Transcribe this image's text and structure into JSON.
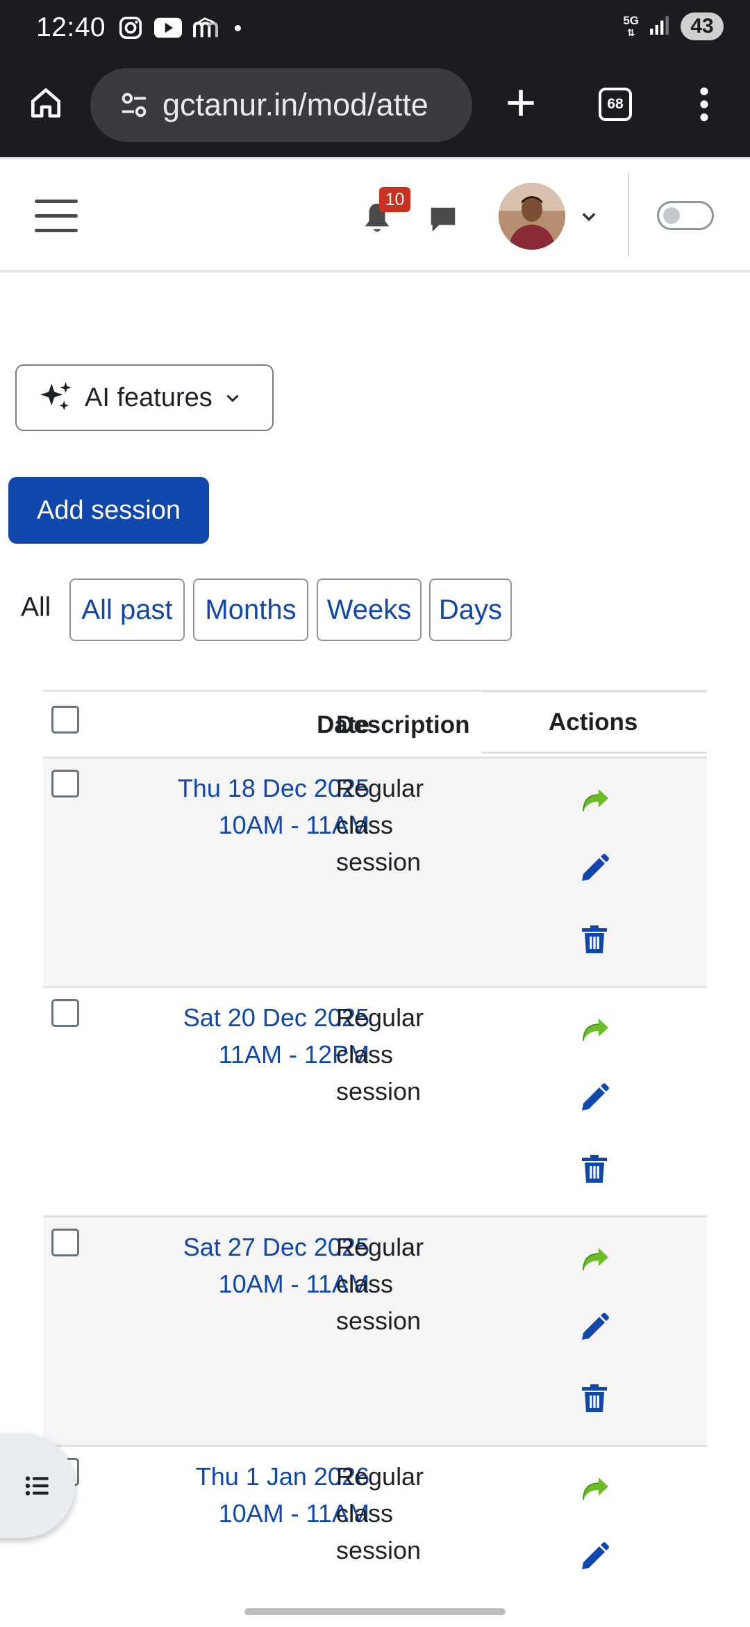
{
  "status_bar": {
    "time": "12:40",
    "network": "5G",
    "battery": "43",
    "icons": [
      "instagram-icon",
      "youtube-icon",
      "moodle-icon",
      "notification-dot-icon",
      "signal-icon",
      "battery-icon"
    ]
  },
  "browser": {
    "url": "gctanur.in/mod/atte",
    "tab_count": "68",
    "icons": [
      "home-icon",
      "site-settings-icon",
      "new-tab-icon",
      "tab-switcher-icon",
      "more-options-icon"
    ]
  },
  "navbar": {
    "notification_count": "10",
    "icons": [
      "hamburger-menu-icon",
      "bell-icon",
      "chat-icon",
      "avatar",
      "chevron-down-icon",
      "toggle-switch"
    ]
  },
  "ai_button": {
    "label": "AI features"
  },
  "add_session": {
    "label": "Add session"
  },
  "view_filters": {
    "current": "All",
    "buttons": [
      "All past",
      "Months",
      "Weeks",
      "Days"
    ]
  },
  "table": {
    "headers": {
      "date": "Date",
      "description": "Description",
      "actions": "Actions"
    },
    "rows": [
      {
        "date": "Thu 18 Dec 2025",
        "time": "10AM - 11AM",
        "description": [
          "Regular",
          "class",
          "session"
        ]
      },
      {
        "date": "Sat 20 Dec 2025",
        "time": "11AM - 12PM",
        "description": [
          "Regular",
          "class",
          "session"
        ]
      },
      {
        "date": "Sat 27 Dec 2025",
        "time": "10AM - 11AM",
        "description": [
          "Regular",
          "class",
          "session"
        ]
      },
      {
        "date": "Thu 1 Jan 2026",
        "time": "10AM - 11AM",
        "description": [
          "Regular",
          "class",
          "session"
        ]
      }
    ]
  },
  "colors": {
    "link_blue": "#0f47ad",
    "take_attendance_green": "#6cbd25",
    "badge_red": "#ca3120",
    "browser_dark": "#1b1c20"
  }
}
